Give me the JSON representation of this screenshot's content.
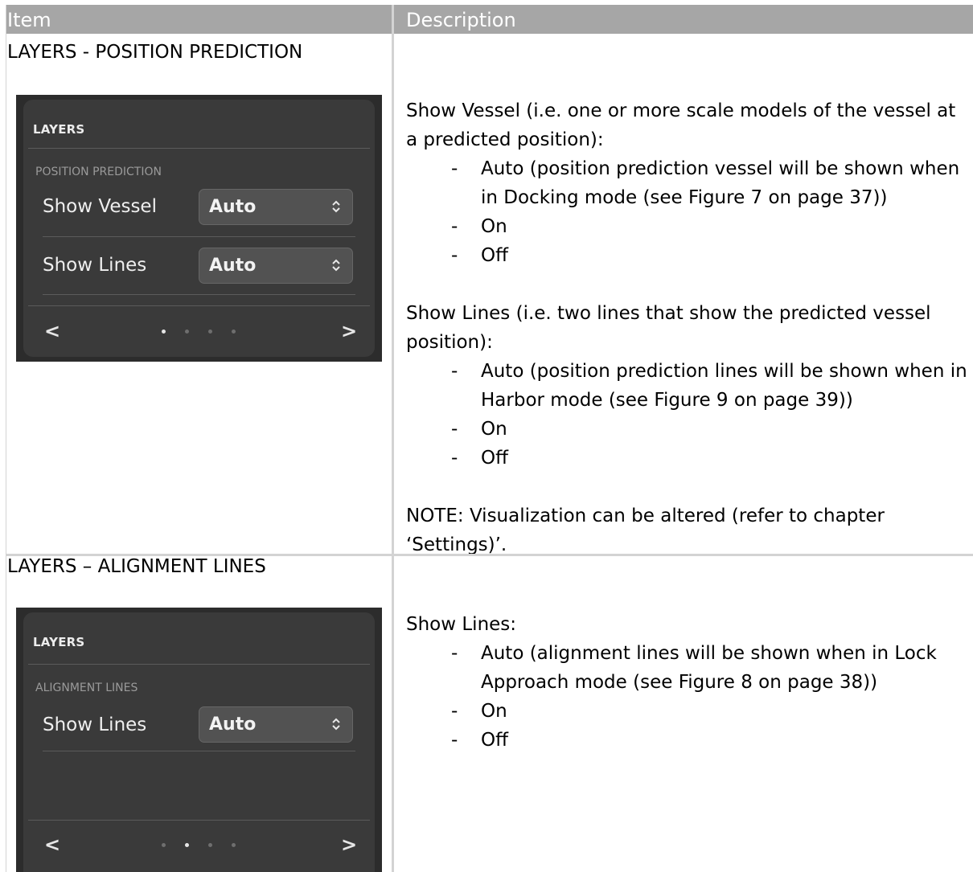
{
  "table": {
    "headers": [
      "Item",
      "Description"
    ]
  },
  "rows": [
    {
      "item_title": "LAYERS - POSITION PREDICTION",
      "panel": {
        "title": "LAYERS",
        "section": "POSITION PREDICTION",
        "settings": [
          {
            "label": "Show Vessel",
            "value": "Auto"
          },
          {
            "label": "Show Lines",
            "value": "Auto"
          }
        ],
        "prev_icon": "<",
        "next_icon": ">",
        "page_count": 4,
        "active_page": 1
      },
      "blocks": [
        {
          "text": "Show Vessel (i.e. one or more scale models of the vessel at a predicted position):",
          "options": [
            "Auto (position prediction vessel will be shown when in Docking mode (see Figure 7 on page 37))",
            "On",
            "Off"
          ]
        },
        {
          "text": "Show Lines (i.e. two lines that show the predicted vessel position):",
          "options": [
            "Auto (position prediction lines will be shown when in Harbor mode (see Figure 9 on page 39))",
            "On",
            "Off"
          ]
        },
        {
          "text": "NOTE: Visualization can be altered (refer to chapter ‘Settings)’.",
          "options": []
        }
      ]
    },
    {
      "item_title": "LAYERS – ALIGNMENT LINES",
      "panel": {
        "title": "LAYERS",
        "section": "ALIGNMENT LINES",
        "settings": [
          {
            "label": "Show Lines",
            "value": "Auto"
          }
        ],
        "prev_icon": "<",
        "next_icon": ">",
        "page_count": 4,
        "active_page": 2
      },
      "blocks": [
        {
          "text": "Show Lines:",
          "options": [
            "Auto (alignment lines will be shown when in Lock Approach mode (see Figure 8 on page 38))",
            "On",
            "Off"
          ]
        }
      ]
    }
  ]
}
